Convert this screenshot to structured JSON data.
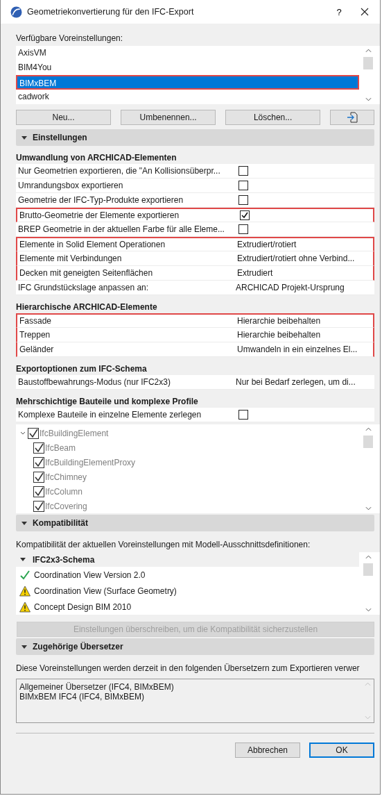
{
  "window": {
    "title": "Geometriekonvertierung für den IFC-Export",
    "help": "?"
  },
  "presets": {
    "label": "Verfügbare Voreinstellungen:",
    "items": [
      {
        "name": "AxisVM",
        "selected": false,
        "highlighted": false
      },
      {
        "name": "BIM4You",
        "selected": false,
        "highlighted": false
      },
      {
        "name": "BIMxBEM",
        "selected": true,
        "highlighted": true
      },
      {
        "name": "cadwork",
        "selected": false,
        "highlighted": false
      }
    ],
    "buttons": [
      "Neu...",
      "Umbenennen...",
      "Löschen..."
    ]
  },
  "settings": {
    "title": "Einstellungen",
    "expanded": true,
    "sections": [
      {
        "title": "Umwandlung von ARCHICAD-Elementen",
        "rows": [
          {
            "kind": "checkbox",
            "label": "Nur Geometrien exportieren, die \"An Kollisionsüberpr...",
            "checked": false,
            "highlighted": false
          },
          {
            "kind": "checkbox",
            "label": "Umrandungsbox exportieren",
            "checked": false,
            "highlighted": false
          },
          {
            "kind": "checkbox",
            "label": "Geometrie der IFC-Typ-Produkte exportieren",
            "checked": false,
            "highlighted": false
          },
          {
            "kind": "checkbox",
            "label": "Brutto-Geometrie der Elemente exportieren",
            "checked": true,
            "highlighted": true
          },
          {
            "kind": "checkbox",
            "label": "BREP Geometrie in der aktuellen Farbe für alle Eleme...",
            "checked": false,
            "highlighted": false
          },
          {
            "kind": "value",
            "label": "Elemente in Solid Element Operationen",
            "value": "Extrudiert/rotiert",
            "highlighted": true
          },
          {
            "kind": "value",
            "label": "Elemente mit Verbindungen",
            "value": "Extrudiert/rotiert ohne Verbind...",
            "highlighted": true
          },
          {
            "kind": "value",
            "label": "Decken mit geneigten Seitenflächen",
            "value": "Extrudiert",
            "highlighted": true
          },
          {
            "kind": "value",
            "label": "IFC Grundstückslage anpassen an:",
            "value": "ARCHICAD Projekt-Ursprung",
            "highlighted": false
          }
        ]
      },
      {
        "title": "Hierarchische ARCHICAD-Elemente",
        "rows": [
          {
            "kind": "value",
            "label": "Fassade",
            "value": "Hierarchie beibehalten",
            "highlighted": true
          },
          {
            "kind": "value",
            "label": "Treppen",
            "value": "Hierarchie beibehalten",
            "highlighted": true
          },
          {
            "kind": "value",
            "label": "Geländer",
            "value": "Umwandeln in ein einzelnes El...",
            "highlighted": true
          }
        ]
      },
      {
        "title": "Exportoptionen zum IFC-Schema",
        "rows": [
          {
            "kind": "value",
            "label": "Baustoffbewahrungs-Modus (nur IFC2x3)",
            "value": "Nur bei Bedarf zerlegen, um di...",
            "highlighted": false
          }
        ]
      },
      {
        "title": "Mehrschichtige Bauteile und komplexe Profile",
        "rows": [
          {
            "kind": "checkbox",
            "label": "Komplexe Bauteile in einzelne Elemente zerlegen",
            "checked": false,
            "highlighted": false
          }
        ],
        "tree": {
          "disabled": true,
          "items": [
            {
              "label": "IfcBuildingElement",
              "checked": true,
              "expanded": true,
              "children": [
                {
                  "label": "IfcBeam",
                  "checked": true
                },
                {
                  "label": "IfcBuildingElementProxy",
                  "checked": true
                },
                {
                  "label": "IfcChimney",
                  "checked": true
                },
                {
                  "label": "IfcColumn",
                  "checked": true
                },
                {
                  "label": "IfcCovering",
                  "checked": true
                }
              ]
            }
          ]
        }
      }
    ]
  },
  "compatibility": {
    "title": "Kompatibilität",
    "expanded": true,
    "description": "Kompatibilität der aktuellen Voreinstellungen mit Modell-Ausschnittsdefinitionen:",
    "group": {
      "title": "IFC2x3-Schema",
      "expanded": true,
      "items": [
        {
          "kind": "ok",
          "label": "Coordination View Version 2.0"
        },
        {
          "kind": "warning",
          "label": "Coordination View (Surface Geometry)"
        },
        {
          "kind": "warning",
          "label": "Concept Design BIM 2010"
        }
      ]
    },
    "button": {
      "label": "Einstellungen überschreiben, um die Kompatibilität sicherzustellen",
      "disabled": true
    }
  },
  "translators": {
    "title": "Zugehörige Übersetzer",
    "expanded": true,
    "description": "Diese Voreinstellungen werden derzeit in den folgenden Übersetzern zum Exportieren verwer",
    "items": [
      "Allgemeiner Übersetzer (IFC4, BIMxBEM)",
      "BIMxBEM IFC4 (IFC4, BIMxBEM)"
    ]
  },
  "footer": [
    {
      "label": "Abbrechen",
      "default": false
    },
    {
      "label": "OK",
      "default": true
    }
  ]
}
